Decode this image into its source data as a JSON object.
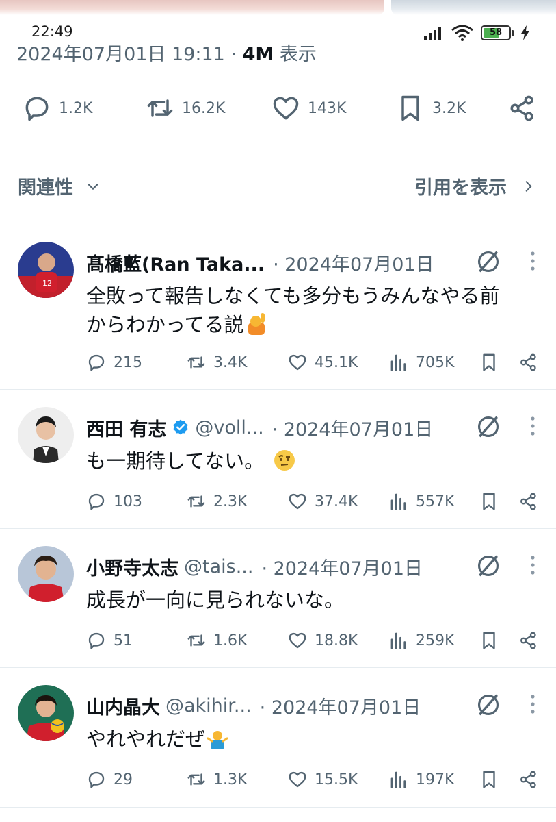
{
  "status_bar": {
    "time": "22:49",
    "battery": "58"
  },
  "post": {
    "date": "2024年07月01日 19:11",
    "separator": "·",
    "views": "4M",
    "views_suffix": "表示",
    "replies": "1.2K",
    "reposts": "16.2K",
    "likes": "143K",
    "bookmarks": "3.2K"
  },
  "sort": {
    "label": "関連性",
    "quotes_label": "引用を表示"
  },
  "replies": [
    {
      "name": "髙橋藍(Ran Taka...",
      "handle": "",
      "date": "· 2024年07月01日",
      "text_line1": "全敗って報告しなくても多分もうみんなやる前",
      "text_line2": "からわかってる説",
      "replies": "215",
      "reposts": "3.4K",
      "likes": "45.1K",
      "views": "705K"
    },
    {
      "name": "西田 有志",
      "handle": "@voll...",
      "date": "· 2024年07月01日",
      "text_line1": "も一期待してない。",
      "text_line2": "",
      "replies": "103",
      "reposts": "2.3K",
      "likes": "37.4K",
      "views": "557K"
    },
    {
      "name": "小野寺太志",
      "handle": "@tais...",
      "date": "· 2024年07月01日",
      "text_line1": "成長が一向に見られないな。",
      "text_line2": "",
      "replies": "51",
      "reposts": "1.6K",
      "likes": "18.8K",
      "views": "259K"
    },
    {
      "name": "山内晶大",
      "handle": "@akihir...",
      "date": "· 2024年07月01日",
      "text_line1": "やれやれだぜ",
      "text_line2": "",
      "replies": "29",
      "reposts": "1.3K",
      "likes": "15.5K",
      "views": "197K"
    }
  ],
  "colors": {
    "text": "#0f1419",
    "muted": "#536471",
    "verified": "#1d9bf0",
    "divider": "#e6ecf0"
  }
}
